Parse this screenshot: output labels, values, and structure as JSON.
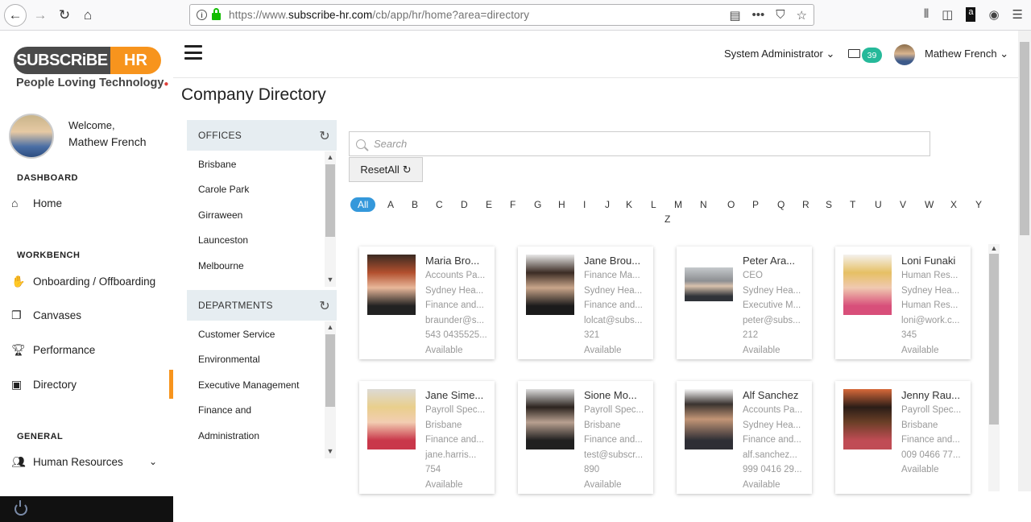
{
  "browser": {
    "url_prefix": "https://www.",
    "url_domain": "subscribe-hr.com",
    "url_path": "/cb/app/hr/home?area=directory"
  },
  "logo": {
    "left": "SUBSCRiBE",
    "right": "HR",
    "tagline": "People Loving Technology"
  },
  "user": {
    "welcome": "Welcome,",
    "name": "Mathew French"
  },
  "sidebar": {
    "dashboard_title": "DASHBOARD",
    "home": "Home",
    "workbench_title": "WORKBENCH",
    "onboarding": "Onboarding / Offboarding",
    "canvases": "Canvases",
    "performance": "Performance",
    "directory": "Directory",
    "general_title": "GENERAL",
    "human_resources": "Human Resources"
  },
  "header": {
    "role": "System Administrator",
    "mail_count": "39",
    "user_name": "Mathew French"
  },
  "page": {
    "title": "Company Directory"
  },
  "offices": {
    "title": "OFFICES",
    "items": [
      "Brisbane",
      "Carole Park",
      "Girraween",
      "Launceston",
      "Melbourne"
    ]
  },
  "departments": {
    "title": "DEPARTMENTS",
    "items": [
      "Customer Service",
      "Environmental",
      "Executive Management",
      "Finance and",
      "Administration"
    ]
  },
  "search": {
    "placeholder": "Search",
    "reset_label": "ResetAll"
  },
  "alphabet": [
    "All",
    "A",
    "B",
    "C",
    "D",
    "E",
    "F",
    "G",
    "H",
    "I",
    "J",
    "K",
    "L",
    "M",
    "N",
    "O",
    "P",
    "Q",
    "R",
    "S",
    "T",
    "U",
    "V",
    "W",
    "X",
    "Y",
    "Z"
  ],
  "employees": [
    {
      "name": "Maria Bro...",
      "title": "Accounts Pa...",
      "office": "Sydney Hea...",
      "dept": "Finance and...",
      "email": "braunder@s...",
      "phone": "543 0435525...",
      "status": "Available"
    },
    {
      "name": "Jane Brou...",
      "title": "Finance Ma...",
      "office": "Sydney Hea...",
      "dept": "Finance and...",
      "email": "lolcat@subs...",
      "phone": "321",
      "status": "Available"
    },
    {
      "name": "Peter Ara...",
      "title": "CEO",
      "office": "Sydney Hea...",
      "dept": "Executive M...",
      "email": "peter@subs...",
      "phone": "212",
      "status": "Available"
    },
    {
      "name": "Loni Funaki",
      "title": "Human Res...",
      "office": "Sydney Hea...",
      "dept": "Human Res...",
      "email": "loni@work.c...",
      "phone": "345",
      "status": "Available"
    },
    {
      "name": "Jane Sime...",
      "title": "Payroll Spec...",
      "office": "Brisbane",
      "dept": "Finance and...",
      "email": "jane.harris...",
      "phone": "754",
      "status": "Available"
    },
    {
      "name": "Sione Mo...",
      "title": "Payroll Spec...",
      "office": "Brisbane",
      "dept": "Finance and...",
      "email": "test@subscr...",
      "phone": "890",
      "status": "Available"
    },
    {
      "name": "Alf Sanchez",
      "title": "Accounts Pa...",
      "office": "Sydney Hea...",
      "dept": "Finance and...",
      "email": "alf.sanchez...",
      "phone": "999 0416 29...",
      "status": "Available"
    },
    {
      "name": "Jenny Rau...",
      "title": "Payroll Spec...",
      "office": "Brisbane",
      "dept": "Finance and...",
      "email": "009 0466 77...",
      "phone": "Available",
      "status": ""
    }
  ]
}
